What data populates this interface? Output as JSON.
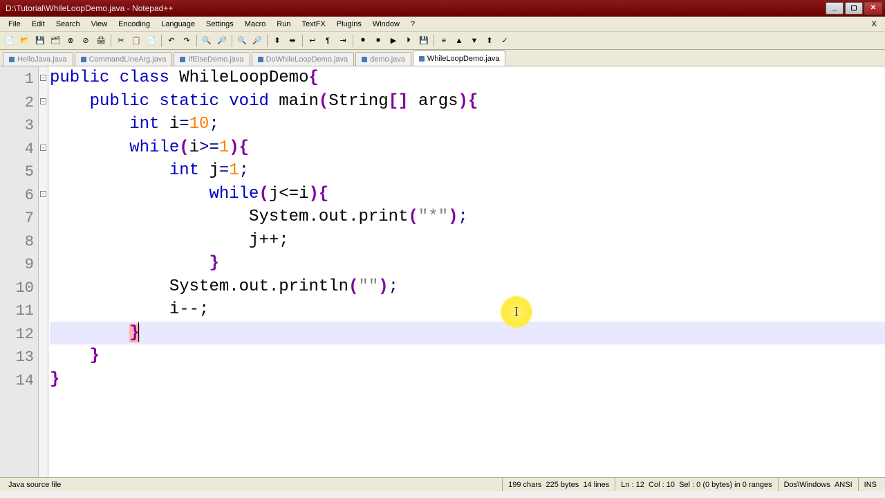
{
  "title": "D:\\Tutorial\\WhileLoopDemo.java - Notepad++",
  "menu": [
    "File",
    "Edit",
    "Search",
    "View",
    "Encoding",
    "Language",
    "Settings",
    "Macro",
    "Run",
    "TextFX",
    "Plugins",
    "Window",
    "?"
  ],
  "tabs": [
    {
      "label": "HelloJava.java",
      "active": false
    },
    {
      "label": "CommandLineArg.java",
      "active": false
    },
    {
      "label": "IfElseDemo.java",
      "active": false
    },
    {
      "label": "DoWhileLoopDemo.java",
      "active": false
    },
    {
      "label": "demo.java",
      "active": false
    },
    {
      "label": "WhileLoopDemo.java",
      "active": true
    }
  ],
  "code": {
    "lines": [
      {
        "n": 1,
        "fold": true
      },
      {
        "n": 2,
        "fold": true
      },
      {
        "n": 3
      },
      {
        "n": 4,
        "fold": true
      },
      {
        "n": 5
      },
      {
        "n": 6,
        "fold": true
      },
      {
        "n": 7
      },
      {
        "n": 8
      },
      {
        "n": 9
      },
      {
        "n": 10
      },
      {
        "n": 11
      },
      {
        "n": 12,
        "current": true
      },
      {
        "n": 13
      },
      {
        "n": 14
      }
    ],
    "l1_kw1": "public",
    "l1_kw2": "class",
    "l1_name": "WhileLoopDemo",
    "l2_kw1": "public",
    "l2_kw2": "static",
    "l2_kw3": "void",
    "l2_name": "main",
    "l2_type": "String",
    "l2_arg": "args",
    "l3_type": "int",
    "l3_var": "i",
    "l3_val": "10",
    "l4_kw": "while",
    "l4_cond_var": "i",
    "l4_cond_val": "1",
    "l5_type": "int",
    "l5_var": "j",
    "l5_val": "1",
    "l6_kw": "while",
    "l6_cond": "j<=i",
    "l7_call": "System.out.print",
    "l7_arg": "\"*\"",
    "l8_stmt": "j++;",
    "l9_brace": "}",
    "l10_call": "System.out.println",
    "l10_arg": "\"\"",
    "l11_stmt": "i--;",
    "l12_brace": "}",
    "l13_brace": "}",
    "l14_brace": "}"
  },
  "status": {
    "filetype": "Java source file",
    "chars": "199 chars",
    "bytes": "225 bytes",
    "lines": "14 lines",
    "ln": "Ln : 12",
    "col": "Col : 10",
    "sel": "Sel : 0 (0 bytes) in 0 ranges",
    "eol": "Dos\\Windows",
    "enc": "ANSI",
    "ins": "INS"
  },
  "close_doc": "X"
}
